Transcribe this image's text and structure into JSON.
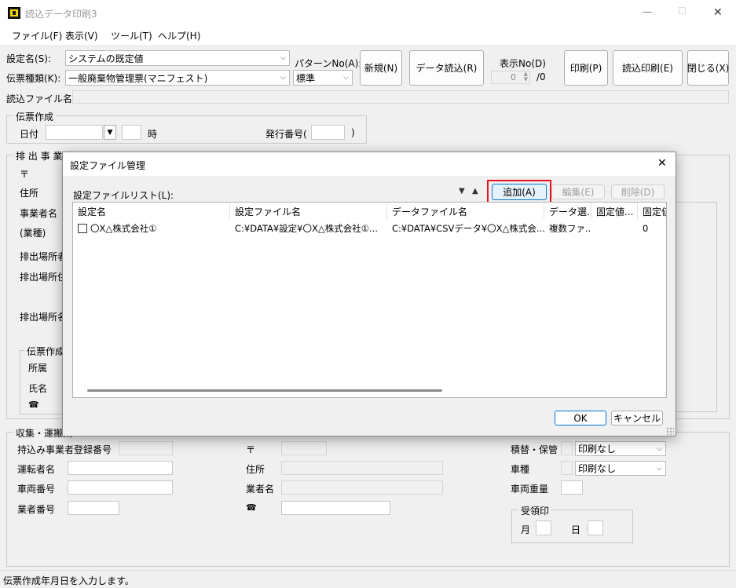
{
  "window": {
    "title": "読込データ印刷3",
    "minimize": "—",
    "maximize": "☐",
    "close": "✕"
  },
  "menu": [
    "ファイル(F)",
    "表示(V)",
    "ツール(T)",
    "ヘルプ(H)"
  ],
  "top": {
    "setting_name_label": "設定名(S):",
    "setting_name_value": "システムの既定値",
    "slip_type_label": "伝票種類(K):",
    "slip_type_value": "一般廃棄物管理票(マニフェスト)",
    "pattern_label": "パターンNo(A):",
    "pattern_value": "標準",
    "new_button": "新規(N)",
    "data_load_button": "データ読込(R)",
    "display_no_label": "表示No(D)",
    "display_no_value": "0",
    "display_no_total": "/0",
    "print_button": "印刷(P)",
    "load_print_button": "読込印刷(E)",
    "close_button": "閉じる(X)",
    "load_file_label": "読込ファイル名"
  },
  "slip_create": {
    "title": "伝票作成",
    "date_label": "日付",
    "hour_label": "時",
    "issue_no_label": "発行番号(",
    "issue_no_close": ")"
  },
  "emitter": {
    "title": "排 出 事 業 者",
    "postal": "〒",
    "address": "住所",
    "business_name": "事業者名",
    "industry": "(業種)",
    "site_label_1": "排出場所者",
    "site_label_2": "排出場所住",
    "site_label_3": "排出場所名",
    "creator_group": "伝票作成",
    "department": "所属",
    "name": "氏名",
    "phone_icon": "☎"
  },
  "collection": {
    "title": "収集・運搬業",
    "registration_no": "持込み事業者登録番号",
    "postal": "〒",
    "driver": "運転者名",
    "address": "住所",
    "vehicle_no": "車両番号",
    "company_name": "業者名",
    "company_no": "業者番号",
    "phone_icon": "☎",
    "transfer_label": "積替・保管",
    "transfer_value": "印刷なし",
    "vehicle_type_label": "車種",
    "vehicle_type_value": "印刷なし",
    "vehicle_weight_label": "車両重量",
    "receipt_stamp": "受領印",
    "month": "月",
    "day": "日"
  },
  "status": "伝票作成年月日を入力します。",
  "dialog": {
    "title": "設定ファイル管理",
    "close": "✕",
    "list_label": "設定ファイルリスト(L):",
    "move_down": "▼",
    "move_up": "▲",
    "add_button": "追加(A)",
    "edit_button": "編集(E)",
    "delete_button": "削除(D)",
    "columns": [
      "設定名",
      "設定ファイル名",
      "データファイル名",
      "データ選...",
      "固定値...",
      "固定値"
    ],
    "rows": [
      {
        "name": "〇X△株式会社①",
        "setting_file": "C:¥DATA¥設定¥〇X△株式会社①...",
        "data_file": "C:¥DATA¥CSVデータ¥〇X△株式会...",
        "data_select": "複数ファ...",
        "fixed1": "",
        "fixed2": "0"
      }
    ],
    "ok_button": "OK",
    "cancel_button": "キャンセル"
  },
  "colors": {
    "highlight": "#e81123",
    "add_button_bg": "#e5f1fb",
    "add_button_border": "#0078d4"
  }
}
